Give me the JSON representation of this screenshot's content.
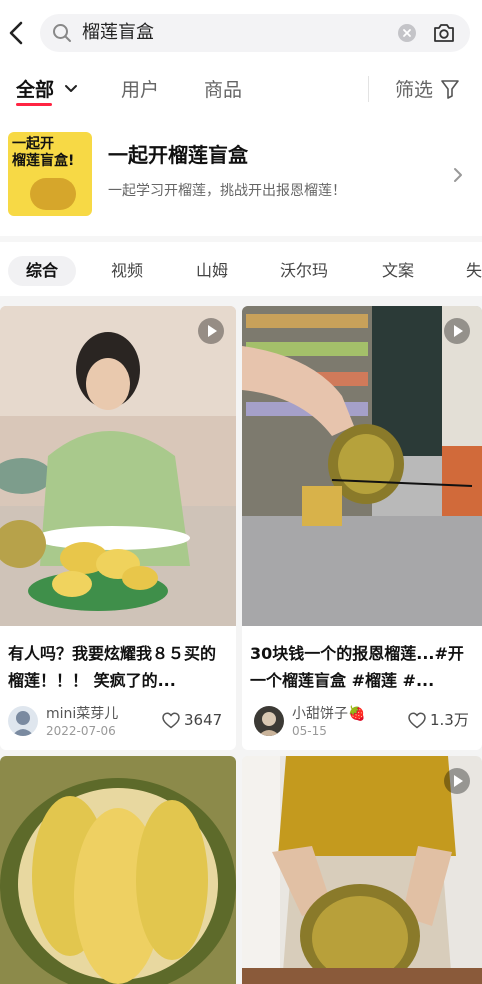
{
  "search": {
    "query": "榴莲盲盒"
  },
  "top_tabs": {
    "all": "全部",
    "users": "用户",
    "products": "商品",
    "filter": "筛选"
  },
  "topic": {
    "cover_text": "一起开\n榴莲盲盒!",
    "title": "一起开榴莲盲盒",
    "description": "一起学习开榴莲，挑战开出报恩榴莲！"
  },
  "categories": [
    "综合",
    "视频",
    "山姆",
    "沃尔玛",
    "文案",
    "失"
  ],
  "posts": [
    {
      "title": "有人吗？我要炫耀我８５买的榴莲！！！ 笑疯了的...",
      "author": "mini菜芽儿",
      "date": "2022-07-06",
      "likes": "3647",
      "is_video": true
    },
    {
      "title": "30块钱一个的报恩榴莲...#开一个榴莲盲盒 #榴莲 #...",
      "author": "小甜饼子🍓",
      "date": "05-15",
      "likes": "1.3万",
      "is_video": true
    },
    {
      "is_video": false
    },
    {
      "is_video": true
    }
  ],
  "colors": {
    "accent": "#ff2442",
    "durian_yellow": "#e8c64a",
    "shirt_green": "#a9c98c",
    "shirt_mustard": "#c49a1e"
  }
}
